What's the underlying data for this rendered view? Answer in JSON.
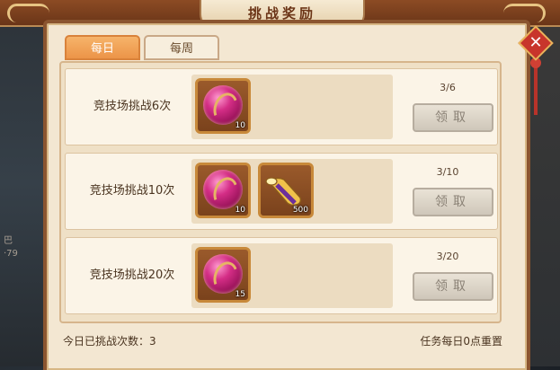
{
  "title": "挑战奖励",
  "background": {
    "left_glyph": "巴\n·79"
  },
  "tabs": [
    {
      "label": "每日",
      "active": true
    },
    {
      "label": "每周",
      "active": false
    }
  ],
  "rows": [
    {
      "label": "竞技场挑战6次",
      "progress": "3/6",
      "rewards": [
        {
          "icon": "pink-orb",
          "count": "10"
        }
      ],
      "claim_label": "领取"
    },
    {
      "label": "竞技场挑战10次",
      "progress": "3/10",
      "rewards": [
        {
          "icon": "pink-orb",
          "count": "10"
        },
        {
          "icon": "horn",
          "count": "500"
        }
      ],
      "claim_label": "领取"
    },
    {
      "label": "竞技场挑战20次",
      "progress": "3/20",
      "rewards": [
        {
          "icon": "pink-orb",
          "count": "15"
        }
      ],
      "claim_label": "领取"
    }
  ],
  "footer": {
    "challenge_count": "今日已挑战次数：3",
    "reset_note": "任务每日0点重置"
  },
  "colors": {
    "panel": "#f3e7d2",
    "tab_active": "#ec9448",
    "close": "#c8352b"
  }
}
